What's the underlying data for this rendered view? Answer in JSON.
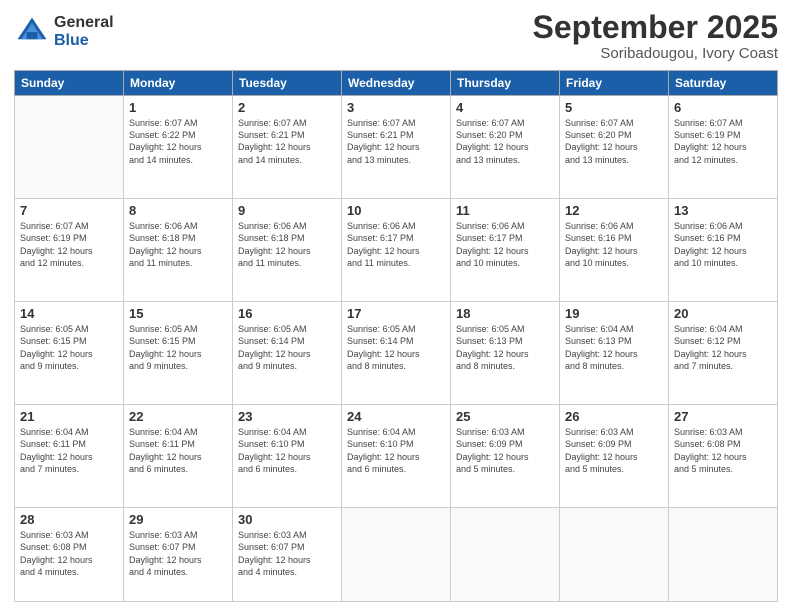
{
  "logo": {
    "general": "General",
    "blue": "Blue"
  },
  "title": "September 2025",
  "subtitle": "Soribadougou, Ivory Coast",
  "weekdays": [
    "Sunday",
    "Monday",
    "Tuesday",
    "Wednesday",
    "Thursday",
    "Friday",
    "Saturday"
  ],
  "weeks": [
    [
      {
        "day": "",
        "info": ""
      },
      {
        "day": "1",
        "info": "Sunrise: 6:07 AM\nSunset: 6:22 PM\nDaylight: 12 hours\nand 14 minutes."
      },
      {
        "day": "2",
        "info": "Sunrise: 6:07 AM\nSunset: 6:21 PM\nDaylight: 12 hours\nand 14 minutes."
      },
      {
        "day": "3",
        "info": "Sunrise: 6:07 AM\nSunset: 6:21 PM\nDaylight: 12 hours\nand 13 minutes."
      },
      {
        "day": "4",
        "info": "Sunrise: 6:07 AM\nSunset: 6:20 PM\nDaylight: 12 hours\nand 13 minutes."
      },
      {
        "day": "5",
        "info": "Sunrise: 6:07 AM\nSunset: 6:20 PM\nDaylight: 12 hours\nand 13 minutes."
      },
      {
        "day": "6",
        "info": "Sunrise: 6:07 AM\nSunset: 6:19 PM\nDaylight: 12 hours\nand 12 minutes."
      }
    ],
    [
      {
        "day": "7",
        "info": "Sunrise: 6:07 AM\nSunset: 6:19 PM\nDaylight: 12 hours\nand 12 minutes."
      },
      {
        "day": "8",
        "info": "Sunrise: 6:06 AM\nSunset: 6:18 PM\nDaylight: 12 hours\nand 11 minutes."
      },
      {
        "day": "9",
        "info": "Sunrise: 6:06 AM\nSunset: 6:18 PM\nDaylight: 12 hours\nand 11 minutes."
      },
      {
        "day": "10",
        "info": "Sunrise: 6:06 AM\nSunset: 6:17 PM\nDaylight: 12 hours\nand 11 minutes."
      },
      {
        "day": "11",
        "info": "Sunrise: 6:06 AM\nSunset: 6:17 PM\nDaylight: 12 hours\nand 10 minutes."
      },
      {
        "day": "12",
        "info": "Sunrise: 6:06 AM\nSunset: 6:16 PM\nDaylight: 12 hours\nand 10 minutes."
      },
      {
        "day": "13",
        "info": "Sunrise: 6:06 AM\nSunset: 6:16 PM\nDaylight: 12 hours\nand 10 minutes."
      }
    ],
    [
      {
        "day": "14",
        "info": "Sunrise: 6:05 AM\nSunset: 6:15 PM\nDaylight: 12 hours\nand 9 minutes."
      },
      {
        "day": "15",
        "info": "Sunrise: 6:05 AM\nSunset: 6:15 PM\nDaylight: 12 hours\nand 9 minutes."
      },
      {
        "day": "16",
        "info": "Sunrise: 6:05 AM\nSunset: 6:14 PM\nDaylight: 12 hours\nand 9 minutes."
      },
      {
        "day": "17",
        "info": "Sunrise: 6:05 AM\nSunset: 6:14 PM\nDaylight: 12 hours\nand 8 minutes."
      },
      {
        "day": "18",
        "info": "Sunrise: 6:05 AM\nSunset: 6:13 PM\nDaylight: 12 hours\nand 8 minutes."
      },
      {
        "day": "19",
        "info": "Sunrise: 6:04 AM\nSunset: 6:13 PM\nDaylight: 12 hours\nand 8 minutes."
      },
      {
        "day": "20",
        "info": "Sunrise: 6:04 AM\nSunset: 6:12 PM\nDaylight: 12 hours\nand 7 minutes."
      }
    ],
    [
      {
        "day": "21",
        "info": "Sunrise: 6:04 AM\nSunset: 6:11 PM\nDaylight: 12 hours\nand 7 minutes."
      },
      {
        "day": "22",
        "info": "Sunrise: 6:04 AM\nSunset: 6:11 PM\nDaylight: 12 hours\nand 6 minutes."
      },
      {
        "day": "23",
        "info": "Sunrise: 6:04 AM\nSunset: 6:10 PM\nDaylight: 12 hours\nand 6 minutes."
      },
      {
        "day": "24",
        "info": "Sunrise: 6:04 AM\nSunset: 6:10 PM\nDaylight: 12 hours\nand 6 minutes."
      },
      {
        "day": "25",
        "info": "Sunrise: 6:03 AM\nSunset: 6:09 PM\nDaylight: 12 hours\nand 5 minutes."
      },
      {
        "day": "26",
        "info": "Sunrise: 6:03 AM\nSunset: 6:09 PM\nDaylight: 12 hours\nand 5 minutes."
      },
      {
        "day": "27",
        "info": "Sunrise: 6:03 AM\nSunset: 6:08 PM\nDaylight: 12 hours\nand 5 minutes."
      }
    ],
    [
      {
        "day": "28",
        "info": "Sunrise: 6:03 AM\nSunset: 6:08 PM\nDaylight: 12 hours\nand 4 minutes."
      },
      {
        "day": "29",
        "info": "Sunrise: 6:03 AM\nSunset: 6:07 PM\nDaylight: 12 hours\nand 4 minutes."
      },
      {
        "day": "30",
        "info": "Sunrise: 6:03 AM\nSunset: 6:07 PM\nDaylight: 12 hours\nand 4 minutes."
      },
      {
        "day": "",
        "info": ""
      },
      {
        "day": "",
        "info": ""
      },
      {
        "day": "",
        "info": ""
      },
      {
        "day": "",
        "info": ""
      }
    ]
  ]
}
